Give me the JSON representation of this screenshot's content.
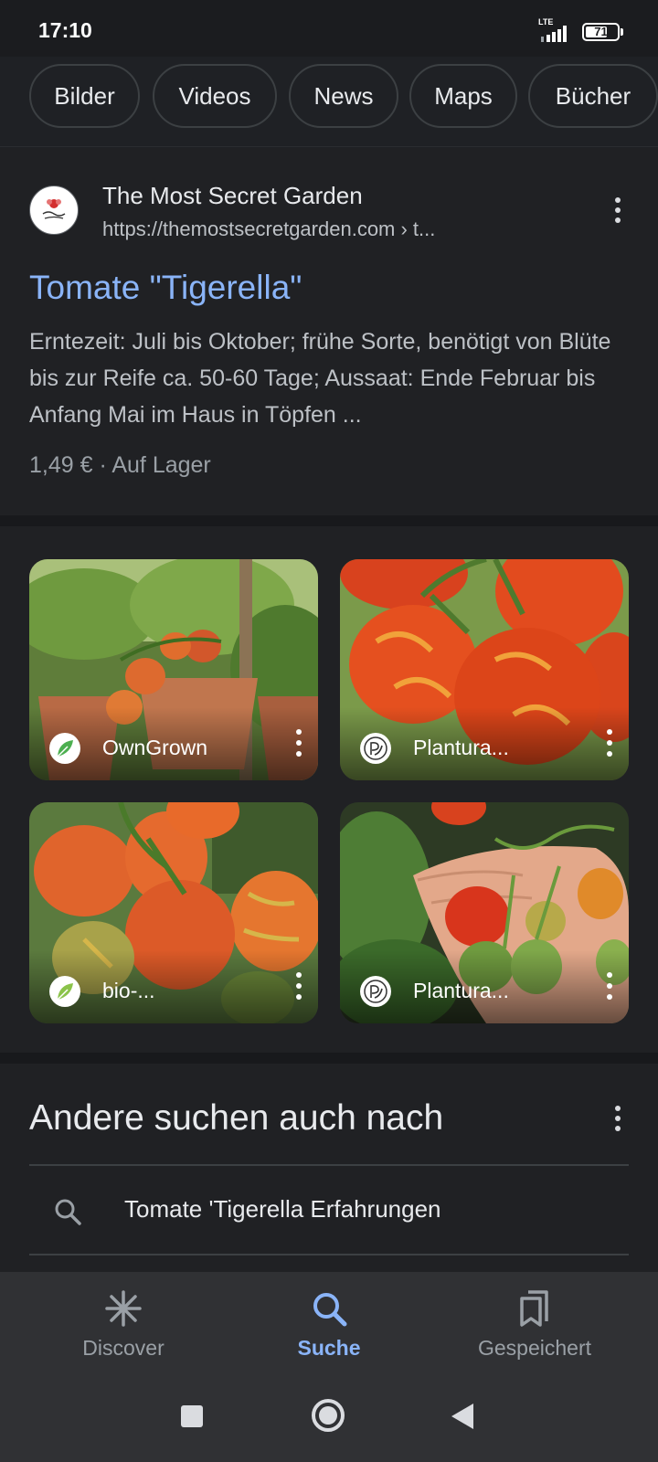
{
  "status_bar": {
    "time": "17:10",
    "network": "LTE",
    "battery": "71",
    "battery_level_percent": 71
  },
  "filter_chips": [
    "Bilder",
    "Videos",
    "News",
    "Maps",
    "Bücher"
  ],
  "result": {
    "site_name": "The Most Secret Garden",
    "url": "https://themostsecretgarden.com › t...",
    "title": "Tomate \"Tigerella\"",
    "snippet": "Erntezeit: Juli bis Oktober; frühe Sorte, benötigt von Blüte bis zur Reife ca. 50-60 Tage; Aussaat: Ende Februar bis Anfang Mai im Haus in Töpfen ...",
    "price_stock": "1,49 € · Auf Lager",
    "favicon_icon": "flower-logo-icon"
  },
  "images": [
    {
      "source": "OwnGrown",
      "icon": "leaf-logo-icon"
    },
    {
      "source": "Plantura...",
      "icon": "plantura-logo-icon"
    },
    {
      "source": "bio-...",
      "icon": "leaf-logo-icon"
    },
    {
      "source": "Plantura...",
      "icon": "plantura-logo-icon"
    }
  ],
  "related_searches": {
    "heading": "Andere suchen auch nach",
    "items": [
      "Tomate 'Tigerella Erfahrungen"
    ]
  },
  "bottom_nav": {
    "items": [
      {
        "label": "Discover",
        "icon": "asterisk-icon",
        "active": false
      },
      {
        "label": "Suche",
        "icon": "search-icon",
        "active": true
      },
      {
        "label": "Gespeichert",
        "icon": "bookmarks-icon",
        "active": false
      }
    ]
  },
  "colors": {
    "background": "#202124",
    "link": "#8ab4f8",
    "text": "#e8eaed",
    "secondary_text": "#bdc1c6"
  }
}
